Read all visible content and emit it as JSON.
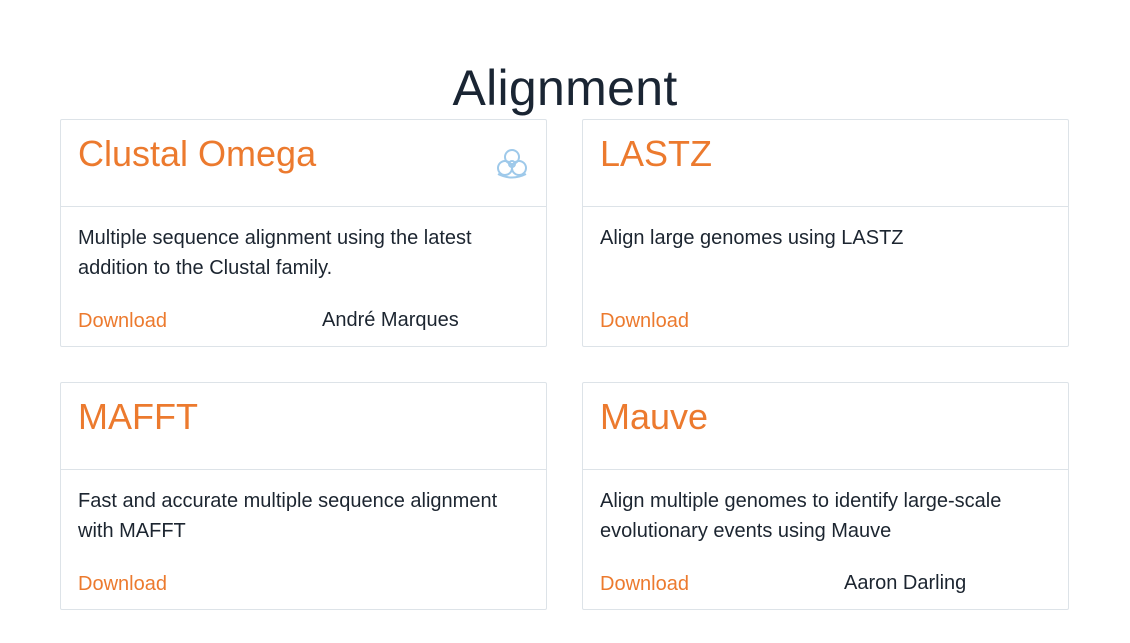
{
  "section": {
    "title": "Alignment"
  },
  "cards": [
    {
      "title": "Clustal Omega",
      "description": "Multiple sequence alignment using the latest addition to the Clustal family.",
      "download_label": "Download",
      "author": "André Marques",
      "icon": "biohazard-icon"
    },
    {
      "title": "LASTZ",
      "description": "Align large genomes using LASTZ",
      "download_label": "Download",
      "author": ""
    },
    {
      "title": "MAFFT",
      "description": "Fast and accurate multiple sequence alignment with MAFFT",
      "download_label": "Download",
      "author": ""
    },
    {
      "title": "Mauve",
      "description": "Align multiple genomes to identify large-scale evolutionary events using Mauve",
      "download_label": "Download",
      "author": "Aaron Darling"
    }
  ],
  "colors": {
    "accent": "#ec7a2e",
    "text": "#1c2530",
    "border": "#dde3e8",
    "icon": "#9ec9ea"
  }
}
